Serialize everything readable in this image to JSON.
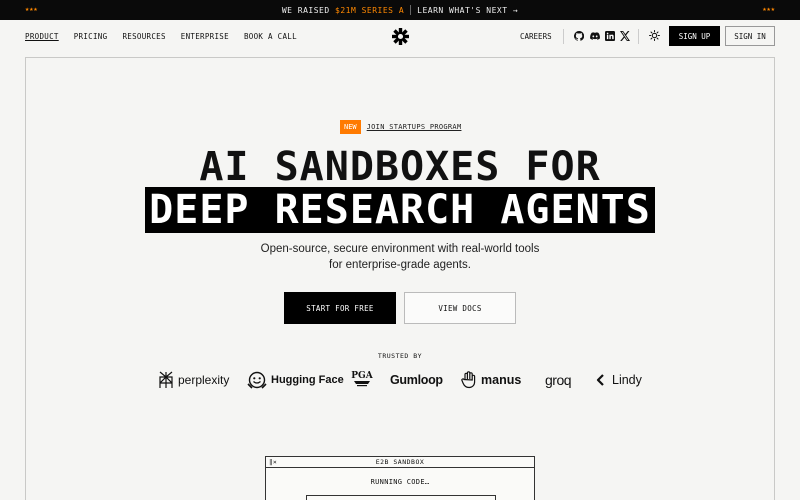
{
  "banner": {
    "stars_left": "★★★",
    "stars_right": "★★★",
    "raised_prefix": "WE RAISED ",
    "raised_amount": "$21M SERIES A",
    "learn": "LEARN WHAT'S NEXT →"
  },
  "nav": {
    "links": [
      "PRODUCT",
      "PRICING",
      "RESOURCES",
      "ENTERPRISE",
      "BOOK A CALL"
    ],
    "careers": "CAREERS",
    "signup": "SIGN UP",
    "signin": "SIGN IN"
  },
  "hero": {
    "badge_new": "NEW",
    "badge_program": "JOIN STARTUPS PROGRAM",
    "title_line1": "AI SANDBOXES FOR",
    "title_line2": "DEEP RESEARCH AGENTS",
    "subtitle_line1": "Open-source, secure environment with real-world tools",
    "subtitle_line2": "for enterprise-grade agents.",
    "cta_primary": "START FOR FREE",
    "cta_secondary": "VIEW DOCS"
  },
  "trusted": {
    "label": "TRUSTED BY",
    "logos": [
      "perplexity",
      "Hugging Face",
      "PGA",
      "Gumloop",
      "manus",
      "groq",
      "Lindy"
    ]
  },
  "sandbox": {
    "controls": "‖×",
    "title": "E2B SANDBOX",
    "status": "RUNNING CODE…"
  },
  "colors": {
    "accent": "#ff7a00",
    "black": "#000000",
    "background": "#f5f5f3"
  }
}
